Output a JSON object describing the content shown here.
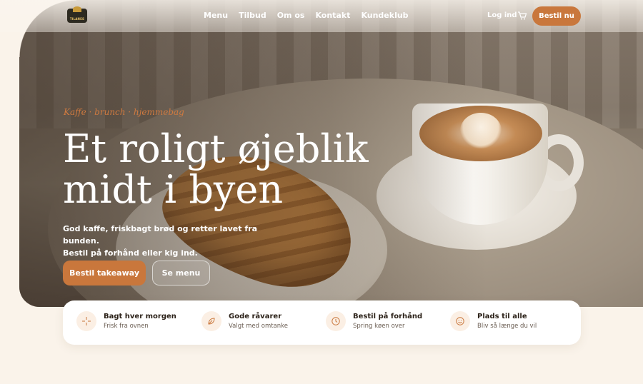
{
  "brand": {
    "logo_text": "TILANES"
  },
  "nav": {
    "items": [
      "Menu",
      "Tilbud",
      "Om os",
      "Kontakt",
      "Kundeklub"
    ],
    "login": "Log ind",
    "order_button": "Bestil nu"
  },
  "hero": {
    "tagline": "Kaffe · brunch · hjemmebag",
    "headline_line1": "Et roligt øjeblik",
    "headline_line2": "midt i byen",
    "subtext_line1": "God kaffe, friskbagt brød og retter lavet fra bunden.",
    "subtext_line2": "Bestil på forhånd eller kig ind.",
    "primary_button": "Bestil takeaway",
    "secondary_button": "Se menu"
  },
  "features": [
    {
      "icon": "sparkle-icon",
      "title": "Bagt hver morgen",
      "subtitle": "Frisk fra ovnen"
    },
    {
      "icon": "leaf-icon",
      "title": "Gode råvarer",
      "subtitle": "Valgt med omtanke"
    },
    {
      "icon": "clock-icon",
      "title": "Bestil på forhånd",
      "subtitle": "Spring køen over"
    },
    {
      "icon": "smile-icon",
      "title": "Plads til alle",
      "subtitle": "Bliv så længe du vil"
    }
  ],
  "colors": {
    "accent": "#c9773c",
    "background": "#faf3ea",
    "text_dark": "#2b2118"
  }
}
